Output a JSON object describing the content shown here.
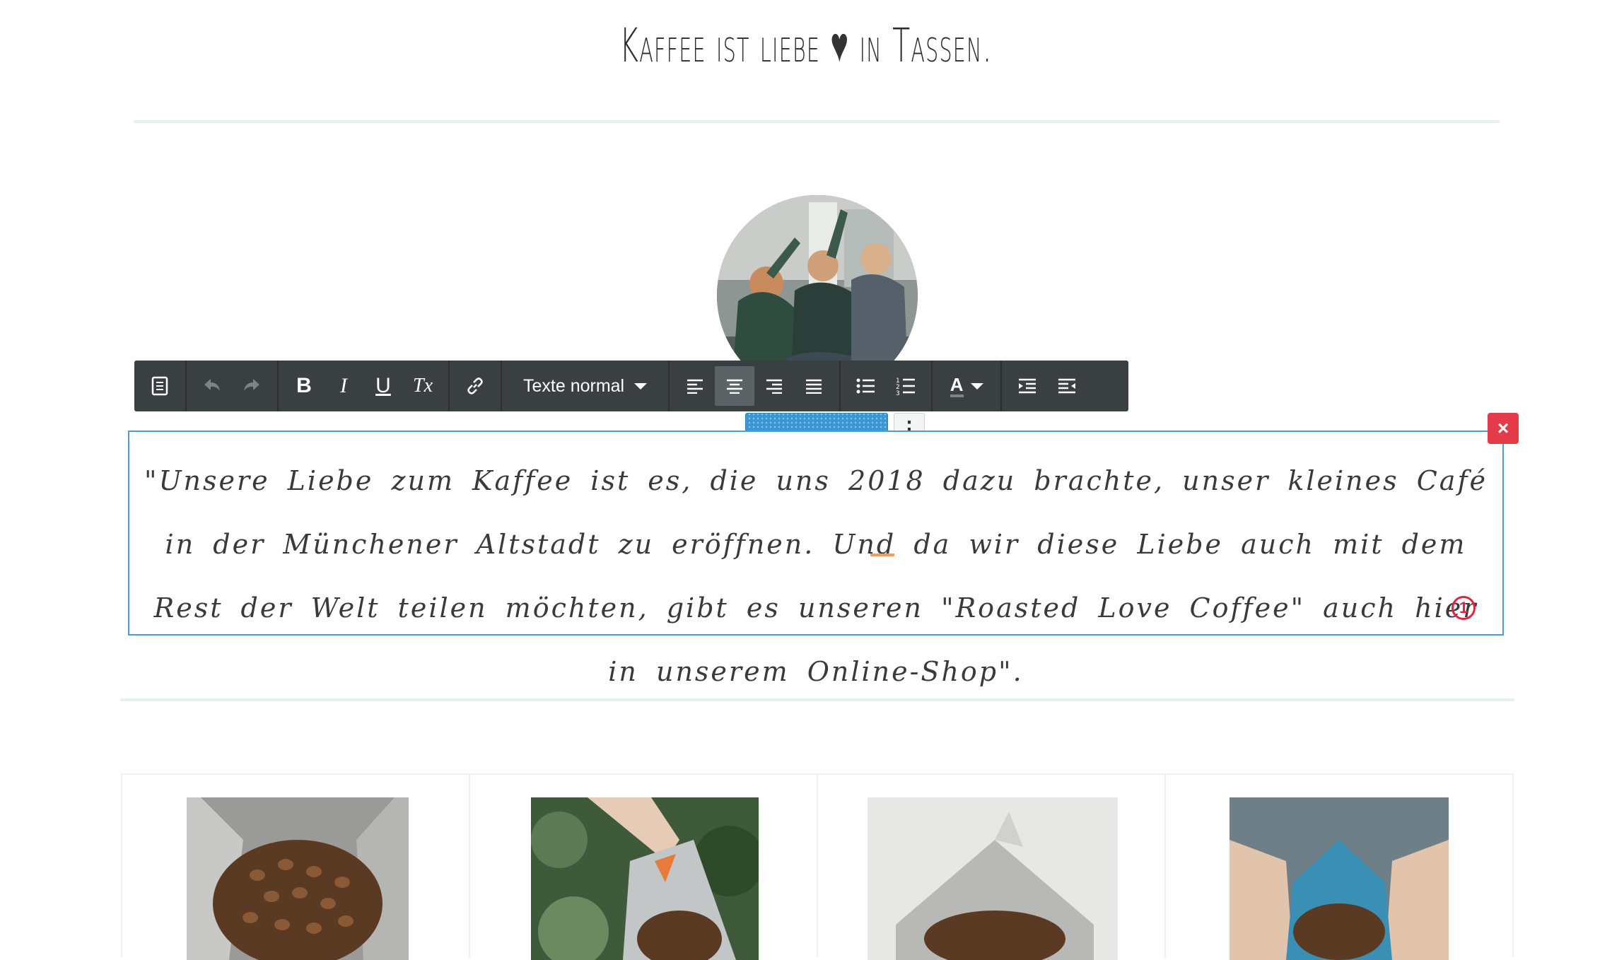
{
  "header": {
    "title_before": "Kaffee ist liebe",
    "heart_glyph": "♥",
    "title_after": "in Tassen."
  },
  "toolbar": {
    "buttons": [
      {
        "name": "source",
        "icon": "document-icon"
      },
      {
        "name": "undo",
        "icon": "undo-icon"
      },
      {
        "name": "redo",
        "icon": "redo-icon"
      },
      {
        "name": "bold",
        "label": "B"
      },
      {
        "name": "italic",
        "label": "I"
      },
      {
        "name": "underline",
        "label": "U"
      },
      {
        "name": "clear-format",
        "label": "Tx"
      },
      {
        "name": "link",
        "icon": "link-icon"
      },
      {
        "name": "align-left",
        "icon": "align-left-icon"
      },
      {
        "name": "align-center",
        "icon": "align-center-icon",
        "active": true
      },
      {
        "name": "align-right",
        "icon": "align-right-icon"
      },
      {
        "name": "justify",
        "icon": "align-justify-icon"
      },
      {
        "name": "bullet-list",
        "icon": "bullet-list-icon"
      },
      {
        "name": "numbered-list",
        "icon": "numbered-list-icon"
      },
      {
        "name": "text-color",
        "label": "A"
      },
      {
        "name": "indent",
        "icon": "indent-icon"
      },
      {
        "name": "outdent",
        "icon": "outdent-icon"
      }
    ],
    "paragraph_style": "Texte normal"
  },
  "editor": {
    "quote": "\"Unsere Liebe zum Kaffee ist es, die uns 2018 dazu brachte, unser kleines Café in der Münchener Altstadt zu eröffnen. Und da wir diese Liebe auch mit dem Rest der Welt teilen möchten, gibt es unseren \"Roasted Love Coffee\" auch hier in unserem Online-Shop\".",
    "badge_count": "1",
    "close_glyph": "×",
    "menu_glyph": "⋮"
  },
  "products": [
    {
      "image": "coffee-bag-silver"
    },
    {
      "image": "coffee-bag-hand-pour"
    },
    {
      "image": "coffee-bag-white-background"
    },
    {
      "image": "coffee-bag-blue-hands"
    }
  ],
  "colors": {
    "toolbar_bg": "#3a3f42",
    "accent_blue": "#3b97d3",
    "close_red": "#e33b4a",
    "divider": "#e6f0ef"
  }
}
